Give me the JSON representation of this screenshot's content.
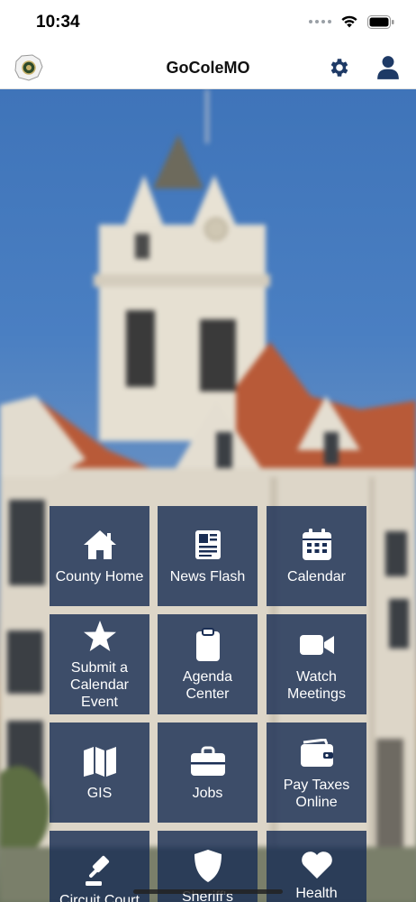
{
  "status_bar": {
    "time": "10:34"
  },
  "app": {
    "title": "GoColeMO"
  },
  "icons": {
    "settings": "gear-icon",
    "account": "user-icon",
    "logo": "county-seal-icon"
  },
  "colors": {
    "tile_bg": "#1a2e54",
    "accent": "#1e3a66"
  },
  "tiles": [
    {
      "label": "County Home",
      "icon": "home-icon"
    },
    {
      "label": "News Flash",
      "icon": "newspaper-icon"
    },
    {
      "label": "Calendar",
      "icon": "calendar-icon"
    },
    {
      "label": "Submit a Calendar Event",
      "icon": "star-icon"
    },
    {
      "label": "Agenda Center",
      "icon": "clipboard-icon"
    },
    {
      "label": "Watch Meetings",
      "icon": "video-camera-icon"
    },
    {
      "label": "GIS",
      "icon": "map-icon"
    },
    {
      "label": "Jobs",
      "icon": "briefcase-icon"
    },
    {
      "label": "Pay Taxes Online",
      "icon": "wallet-icon"
    },
    {
      "label": "Circuit Court",
      "icon": "gavel-icon"
    },
    {
      "label": "Sheriff's",
      "icon": "shield-icon"
    },
    {
      "label": "Health",
      "icon": "heart-icon"
    }
  ]
}
